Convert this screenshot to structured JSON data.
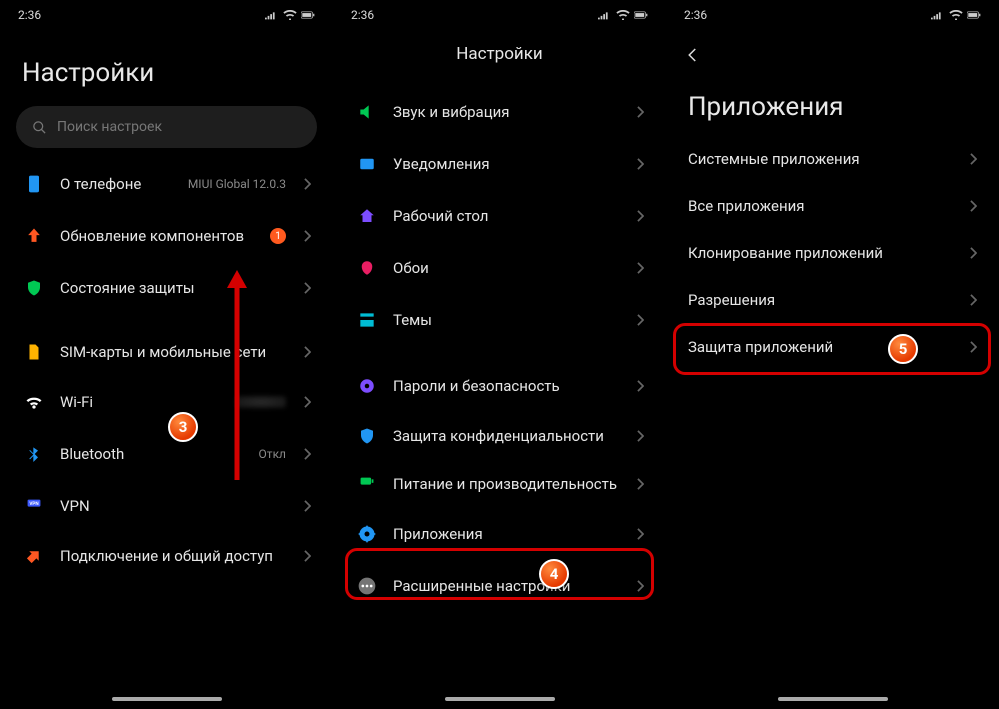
{
  "status": {
    "time": "2:36"
  },
  "screen1": {
    "title": "Настройки",
    "search_placeholder": "Поиск настроек",
    "about_label": "О телефоне",
    "about_value": "MIUI Global 12.0.3",
    "updater_label": "Обновление компонентов",
    "updater_badge": "1",
    "security_label": "Состояние защиты",
    "sim_label": "SIM-карты и мобильные сети",
    "wifi_label": "Wi-Fi",
    "bt_label": "Bluetooth",
    "bt_value": "Откл",
    "vpn_label": "VPN",
    "hotspot_label": "Подключение и общий доступ"
  },
  "screen2": {
    "title": "Настройки",
    "sound_label": "Звук и вибрация",
    "notif_label": "Уведомления",
    "home_label": "Рабочий стол",
    "wall_label": "Обои",
    "theme_label": "Темы",
    "lock_label": "Пароли и безопасность",
    "priv_label": "Защита конфиденциальности",
    "bat_label": "Питание и производительность",
    "apps_label": "Приложения",
    "more_label": "Расширенные настройки"
  },
  "screen3": {
    "title": "Приложения",
    "sys_label": "Системные приложения",
    "all_label": "Все приложения",
    "dual_label": "Клонирование приложений",
    "perm_label": "Разрешения",
    "prot_label": "Защита приложений"
  },
  "steps": {
    "s3": "3",
    "s4": "4",
    "s5": "5"
  }
}
